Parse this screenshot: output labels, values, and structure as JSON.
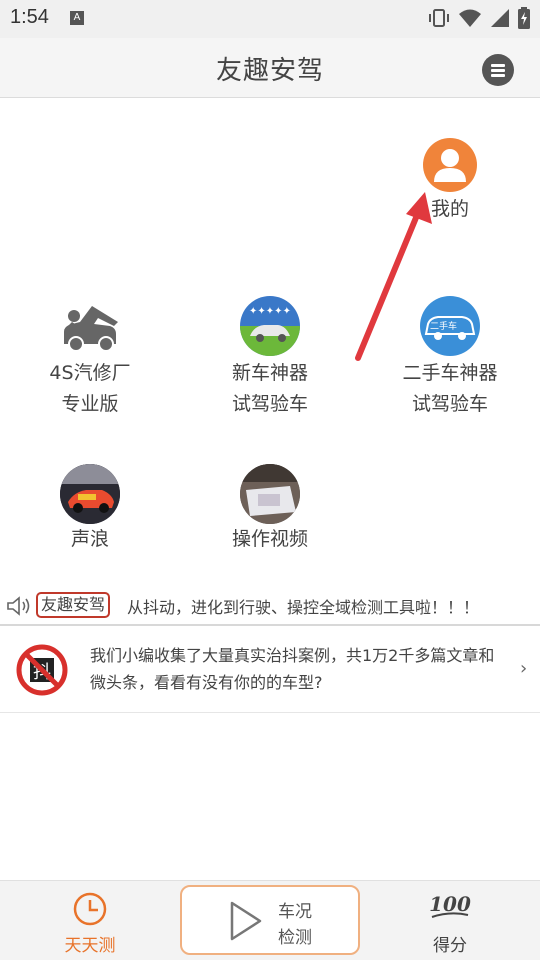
{
  "status_bar": {
    "time": "1:54",
    "notification_badge": "A",
    "icons": [
      "vibrate-icon",
      "wifi-icon",
      "signal-icon",
      "battery-icon"
    ]
  },
  "header": {
    "title": "友趣安驾",
    "menu_icon": "menu-icon"
  },
  "grid": {
    "profile": {
      "label": "我的",
      "icon": "user-icon",
      "color": "#f0843a"
    },
    "repair_shop": {
      "line1": "4S汽修厂",
      "line2": "专业版",
      "icon": "car-repair-icon"
    },
    "new_car": {
      "line1": "新车神器",
      "line2": "试驾验车",
      "icon": "new-car-icon"
    },
    "used_car": {
      "line1": "二手车神器",
      "line2": "试驾验车",
      "icon_text": "二手车",
      "icon": "used-car-icon",
      "color": "#3a8fd8"
    },
    "sound": {
      "label": "声浪",
      "icon": "race-car-photo"
    },
    "video": {
      "label": "操作视频",
      "icon": "video-thumbnail"
    }
  },
  "marquee": {
    "tag": "友趣安驾",
    "text": "从抖动，进化到行驶、操控全域检测工具啦！！！",
    "icon": "speaker-icon"
  },
  "news": {
    "text": "我们小编收集了大量真实治抖案例，共1万2千多篇文章和微头条，看看有没有你的的车型?",
    "icon": "no-shake-icon"
  },
  "bottom_nav": {
    "daily": {
      "label": "天天测",
      "icon": "clock-icon",
      "color": "#e8732a"
    },
    "center": {
      "line1": "车况",
      "line2": "检测",
      "icon": "play-icon"
    },
    "score": {
      "label": "得分",
      "icon": "score-100-icon"
    }
  },
  "annotation": {
    "icon": "red-arrow-icon",
    "color": "#e0393e"
  }
}
